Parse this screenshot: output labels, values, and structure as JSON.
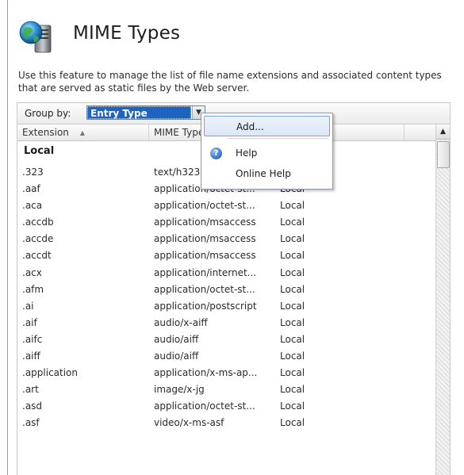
{
  "page": {
    "title": "MIME Types",
    "description": "Use this feature to manage the list of file name extensions and associated content types that are served as static files by the Web server."
  },
  "toolbar": {
    "group_by_label": "Group by:",
    "group_by_value": "Entry Type"
  },
  "list": {
    "columns": [
      "Extension",
      "MIME Type",
      ""
    ],
    "group_label": "Local",
    "rows": [
      {
        "ext": ".323",
        "mime": "text/h323",
        "type": "Local"
      },
      {
        "ext": ".aaf",
        "mime": "application/octet-st...",
        "type": "Local"
      },
      {
        "ext": ".aca",
        "mime": "application/octet-st...",
        "type": "Local"
      },
      {
        "ext": ".accdb",
        "mime": "application/msaccess",
        "type": "Local"
      },
      {
        "ext": ".accde",
        "mime": "application/msaccess",
        "type": "Local"
      },
      {
        "ext": ".accdt",
        "mime": "application/msaccess",
        "type": "Local"
      },
      {
        "ext": ".acx",
        "mime": "application/internet...",
        "type": "Local"
      },
      {
        "ext": ".afm",
        "mime": "application/octet-st...",
        "type": "Local"
      },
      {
        "ext": ".ai",
        "mime": "application/postscript",
        "type": "Local"
      },
      {
        "ext": ".aif",
        "mime": "audio/x-aiff",
        "type": "Local"
      },
      {
        "ext": ".aifc",
        "mime": "audio/aiff",
        "type": "Local"
      },
      {
        "ext": ".aiff",
        "mime": "audio/aiff",
        "type": "Local"
      },
      {
        "ext": ".application",
        "mime": "application/x-ms-ap...",
        "type": "Local"
      },
      {
        "ext": ".art",
        "mime": "image/x-jg",
        "type": "Local"
      },
      {
        "ext": ".asd",
        "mime": "application/octet-st...",
        "type": "Local"
      },
      {
        "ext": ".asf",
        "mime": "video/x-ms-asf",
        "type": "Local"
      }
    ]
  },
  "context_menu": {
    "items": [
      "Add...",
      "Help",
      "Online Help"
    ],
    "icons": {
      "help": "help-icon"
    }
  },
  "colors": {
    "selection": "#1e63c0",
    "menu_hover": "#dbe6f6",
    "help_icon": "#2f6fc1"
  }
}
